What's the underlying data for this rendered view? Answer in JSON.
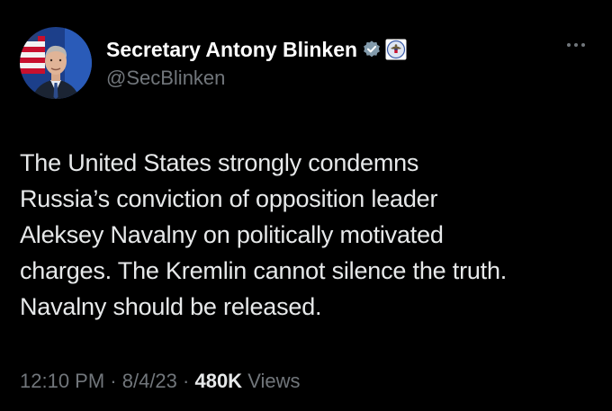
{
  "tweet": {
    "author": {
      "display_name": "Secretary Antony Blinken",
      "handle": "@SecBlinken",
      "avatar_icon": "profile-photo",
      "verified_icon": "verified-badge-icon",
      "affiliation_icon": "us-state-department-seal-icon"
    },
    "more_icon": "more-options-icon",
    "text": "The United States strongly condemns\nRussia’s conviction of opposition leader\nAleksey Navalny on politically motivated\ncharges. The Kremlin cannot silence the truth.\nNavalny should be released.",
    "meta": {
      "time": "12:10 PM",
      "separator": " · ",
      "date": "8/4/23",
      "views_count": "480K",
      "views_label": "Views"
    }
  },
  "colors": {
    "background": "#000000",
    "primary_text": "#e7e9ea",
    "secondary_text": "#71767b",
    "verified_badge": "#829aab"
  }
}
